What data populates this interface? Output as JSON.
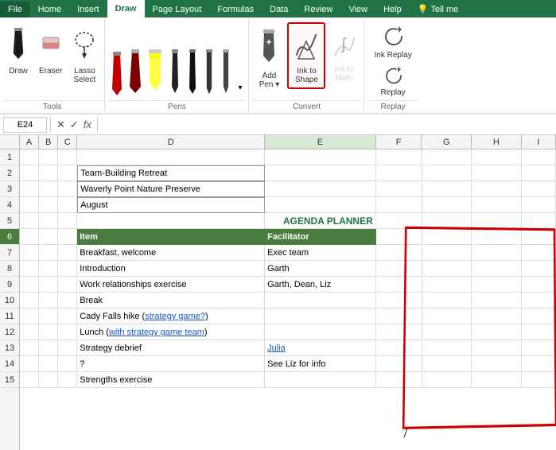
{
  "tabs": [
    "File",
    "Home",
    "Insert",
    "Draw",
    "Page Layout",
    "Formulas",
    "Data",
    "Review",
    "View",
    "Help"
  ],
  "active_tab": "Draw",
  "tools_group": {
    "label": "Tools",
    "buttons": [
      {
        "name": "draw",
        "label": "Draw",
        "icon": "✏️"
      },
      {
        "name": "eraser",
        "label": "Eraser",
        "icon": "⬜"
      },
      {
        "name": "lasso-select",
        "label": "Lasso Select",
        "icon": "⬡"
      }
    ]
  },
  "pens_group": {
    "label": "Pens"
  },
  "convert_group": {
    "label": "Convert",
    "buttons": [
      {
        "name": "add-pen",
        "label": "Add Pen ▾",
        "icon": "➕"
      },
      {
        "name": "ink-to-shape",
        "label": "Ink to Shape",
        "icon": "△",
        "active": true
      },
      {
        "name": "ink-to-math",
        "label": "Ink to Math",
        "icon": "∫",
        "disabled": true
      },
      {
        "name": "ink-replay",
        "label": "Ink Replay",
        "icon": "↩"
      }
    ]
  },
  "replay_group": {
    "label": "Replay",
    "buttons": [
      {
        "name": "replay",
        "label": "Replay",
        "icon": "↩"
      }
    ]
  },
  "formula_bar": {
    "cell_ref": "E24",
    "formula": ""
  },
  "columns": [
    "A",
    "B",
    "C",
    "D",
    "E",
    "F",
    "G",
    "H",
    "I"
  ],
  "rows": [
    {
      "num": 1,
      "cells": [
        "",
        "",
        "",
        "",
        "",
        "",
        "",
        "",
        ""
      ]
    },
    {
      "num": 2,
      "cells": [
        "",
        "",
        "",
        "Team-Building Retreat",
        "",
        "",
        "",
        "",
        ""
      ]
    },
    {
      "num": 3,
      "cells": [
        "",
        "",
        "",
        "Waverly Point Nature Preserve",
        "",
        "",
        "",
        "",
        ""
      ]
    },
    {
      "num": 4,
      "cells": [
        "",
        "",
        "",
        "August",
        "",
        "",
        "",
        "",
        ""
      ]
    },
    {
      "num": 5,
      "cells": [
        "",
        "",
        "",
        "",
        "AGENDA PLANNER",
        "",
        "",
        "",
        ""
      ]
    },
    {
      "num": 6,
      "cells": [
        "",
        "",
        "",
        "Item",
        "Facilitator",
        "",
        "",
        "",
        ""
      ]
    },
    {
      "num": 7,
      "cells": [
        "",
        "",
        "",
        "Breakfast, welcome",
        "Exec team",
        "",
        "",
        "",
        ""
      ]
    },
    {
      "num": 8,
      "cells": [
        "",
        "",
        "",
        "Introduction",
        "Garth",
        "",
        "",
        "",
        ""
      ]
    },
    {
      "num": 9,
      "cells": [
        "",
        "",
        "",
        "Work relationships exercise",
        "Garth, Dean, Liz",
        "",
        "",
        "",
        ""
      ]
    },
    {
      "num": 10,
      "cells": [
        "",
        "",
        "",
        "Break",
        "",
        "",
        "",
        "",
        ""
      ]
    },
    {
      "num": 11,
      "cells": [
        "",
        "",
        "",
        "Cady Falls hike (strategy game?)",
        "",
        "",
        "",
        "",
        ""
      ]
    },
    {
      "num": 12,
      "cells": [
        "",
        "",
        "",
        "Lunch (with strategy game team)",
        "",
        "",
        "",
        "",
        ""
      ]
    },
    {
      "num": 13,
      "cells": [
        "",
        "",
        "",
        "Strategy debrief",
        "Julia",
        "",
        "",
        "",
        ""
      ]
    },
    {
      "num": 14,
      "cells": [
        "",
        "",
        "",
        "?",
        "See Liz for info",
        "",
        "",
        "",
        ""
      ]
    },
    {
      "num": 15,
      "cells": [
        "",
        "",
        "",
        "Strengths exercise",
        "",
        "",
        "",
        "",
        ""
      ]
    }
  ],
  "cell_styles": {
    "row2_d": {
      "border": true
    },
    "row3_d": {
      "border": true
    },
    "row4_d": {
      "border": true
    },
    "row5_e": {
      "agenda": true
    },
    "row6_d": {
      "green_header": true
    },
    "row6_e": {
      "green_header": true
    },
    "row11_d": {
      "has_link": true,
      "link_text": "strategy game?"
    },
    "row12_d": {
      "has_link": true,
      "link_text": "with strategy game team"
    },
    "row13_e": {
      "blue_link": true
    },
    "row14_e": {
      "normal": true
    }
  }
}
